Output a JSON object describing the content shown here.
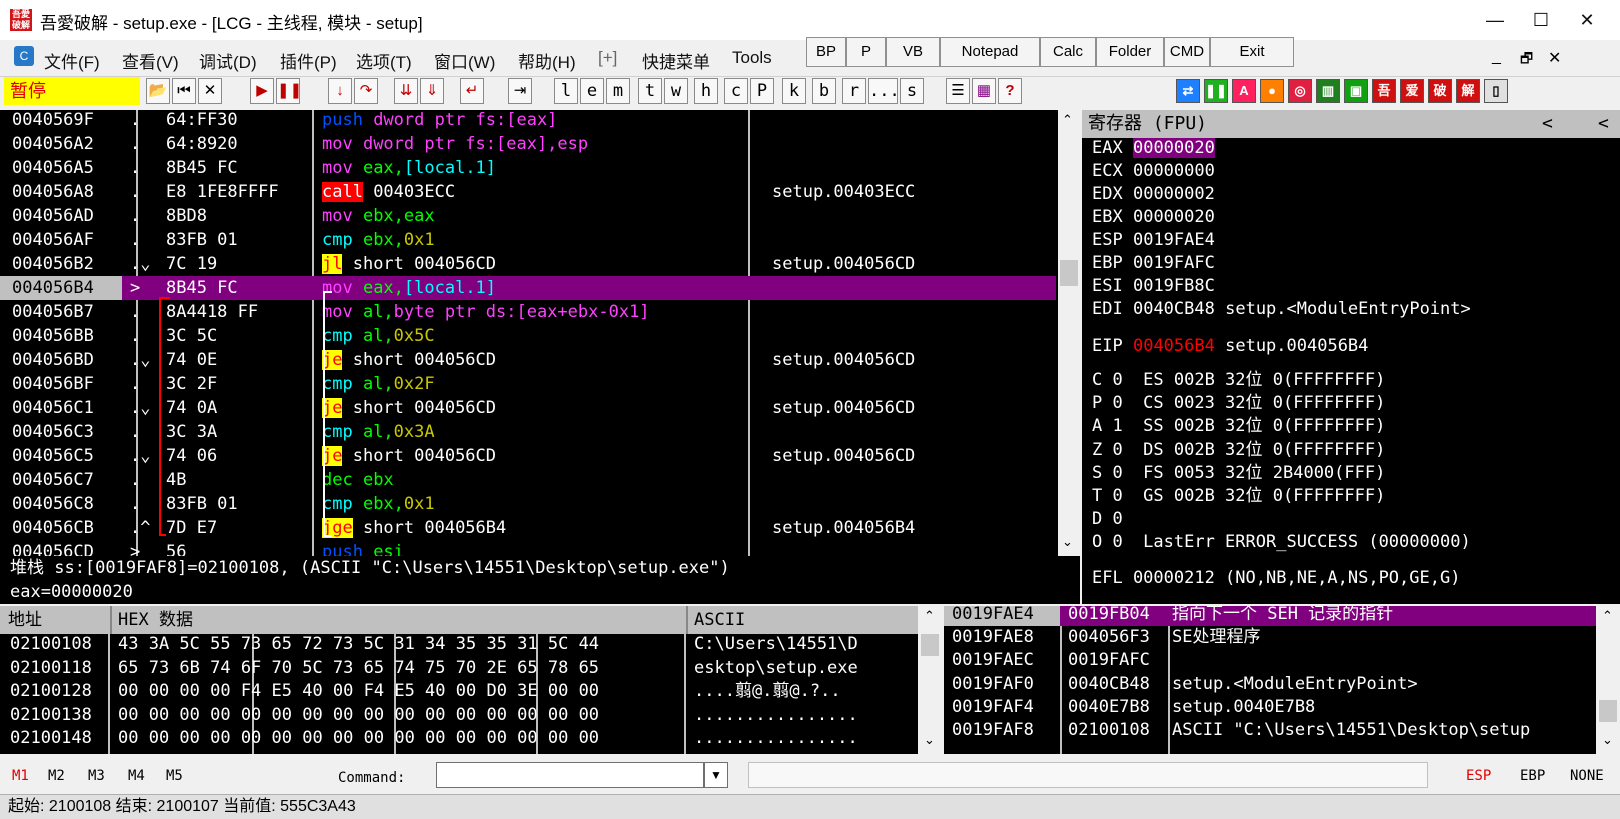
{
  "window": {
    "title": "吾愛破解 - setup.exe - [LCG - 主线程, 模块 - setup]",
    "icon_text": "吾愛破解",
    "minimize": "—",
    "maximize": "☐",
    "close": "✕"
  },
  "menu": [
    "文件(F)",
    "查看(V)",
    "调试(D)",
    "插件(P)",
    "选项(T)",
    "窗口(W)",
    "帮助(H)",
    "[+]",
    "快捷菜单",
    "Tools"
  ],
  "quick_buttons": [
    "BP",
    "P",
    "VB",
    "Notepad",
    "Calc",
    "Folder",
    "CMD",
    "Exit"
  ],
  "mdi_controls": [
    "_",
    "🗗",
    "✕"
  ],
  "toolbar": {
    "status": "暂停",
    "letters": [
      "l",
      "e",
      "m",
      "t",
      "w",
      "h",
      "c",
      "P",
      "k",
      "b",
      "r",
      "...",
      "s"
    ],
    "plugin_icons": [
      "吾",
      "爱",
      "破",
      "解"
    ],
    "plugin_letter": "A"
  },
  "disasm": [
    {
      "addr": "0040569F",
      "mark": ".",
      "hex": "64:FF30",
      "ins": [
        [
          "push",
          "k-push"
        ],
        [
          " dword ptr fs:[eax]",
          "k-op"
        ]
      ],
      "com": ""
    },
    {
      "addr": "004056A2",
      "mark": ".",
      "hex": "64:8920",
      "ins": [
        [
          "mov",
          "k-mov"
        ],
        [
          " dword ptr fs:[eax],esp",
          "k-op"
        ]
      ],
      "com": ""
    },
    {
      "addr": "004056A5",
      "mark": ".",
      "hex": "8B45 FC",
      "ins": [
        [
          "mov",
          "k-mov"
        ],
        [
          " eax,",
          "k-reg"
        ],
        [
          "[local.1]",
          "k-cyan"
        ]
      ],
      "com": ""
    },
    {
      "addr": "004056A8",
      "mark": ".",
      "hex": "E8 1FE8FFFF",
      "ins": [
        [
          "call",
          "k-call"
        ],
        [
          " 00403ECC",
          "k-arg"
        ]
      ],
      "com": "setup.00403ECC"
    },
    {
      "addr": "004056AD",
      "mark": ".",
      "hex": "8BD8",
      "ins": [
        [
          "mov",
          "k-mov"
        ],
        [
          " ebx,eax",
          "k-reg"
        ]
      ],
      "com": ""
    },
    {
      "addr": "004056AF",
      "mark": ".",
      "hex": "83FB 01",
      "ins": [
        [
          "cmp",
          "k-cmp"
        ],
        [
          " ebx,",
          "k-reg"
        ],
        [
          "0x1",
          "k-ol"
        ]
      ],
      "com": ""
    },
    {
      "addr": "004056B2",
      "mark": ".⌄",
      "hex": "7C 19",
      "ins": [
        [
          "jl",
          "k-jmp"
        ],
        [
          " short 004056CD",
          "k-arg"
        ]
      ],
      "com": "setup.004056CD"
    },
    {
      "addr": "004056B4",
      "mark": ">",
      "hex": "8B45 FC",
      "ins": [
        [
          "mov",
          "k-mov"
        ],
        [
          " eax,",
          "k-reg"
        ],
        [
          "[local.1]",
          "k-cyan"
        ]
      ],
      "com": "",
      "sel": true
    },
    {
      "addr": "004056B7",
      "mark": ".",
      "hex": "8A4418 FF",
      "ins": [
        [
          "mov",
          "k-mov"
        ],
        [
          " al,",
          "k-reg"
        ],
        [
          "byte ptr ds:[eax+ebx-0x1]",
          "k-op"
        ]
      ],
      "com": ""
    },
    {
      "addr": "004056BB",
      "mark": ".",
      "hex": "3C 5C",
      "ins": [
        [
          "cmp",
          "k-cmp"
        ],
        [
          " al,",
          "k-reg"
        ],
        [
          "0x5C",
          "k-ol"
        ]
      ],
      "com": ""
    },
    {
      "addr": "004056BD",
      "mark": ".⌄",
      "hex": "74 0E",
      "ins": [
        [
          "je",
          "k-jmp"
        ],
        [
          " short 004056CD",
          "k-arg"
        ]
      ],
      "com": "setup.004056CD"
    },
    {
      "addr": "004056BF",
      "mark": ".",
      "hex": "3C 2F",
      "ins": [
        [
          "cmp",
          "k-cmp"
        ],
        [
          " al,",
          "k-reg"
        ],
        [
          "0x2F",
          "k-ol"
        ]
      ],
      "com": ""
    },
    {
      "addr": "004056C1",
      "mark": ".⌄",
      "hex": "74 0A",
      "ins": [
        [
          "je",
          "k-jmp"
        ],
        [
          " short 004056CD",
          "k-arg"
        ]
      ],
      "com": "setup.004056CD"
    },
    {
      "addr": "004056C3",
      "mark": ".",
      "hex": "3C 3A",
      "ins": [
        [
          "cmp",
          "k-cmp"
        ],
        [
          " al,",
          "k-reg"
        ],
        [
          "0x3A",
          "k-ol"
        ]
      ],
      "com": ""
    },
    {
      "addr": "004056C5",
      "mark": ".⌄",
      "hex": "74 06",
      "ins": [
        [
          "je",
          "k-jmp"
        ],
        [
          " short 004056CD",
          "k-arg"
        ]
      ],
      "com": "setup.004056CD"
    },
    {
      "addr": "004056C7",
      "mark": ".",
      "hex": "4B",
      "ins": [
        [
          "dec",
          "k-dec"
        ],
        [
          " ebx",
          "k-reg"
        ]
      ],
      "com": ""
    },
    {
      "addr": "004056C8",
      "mark": ".",
      "hex": "83FB 01",
      "ins": [
        [
          "cmp",
          "k-cmp"
        ],
        [
          " ebx,",
          "k-reg"
        ],
        [
          "0x1",
          "k-ol"
        ]
      ],
      "com": ""
    },
    {
      "addr": "004056CB",
      "mark": ".^",
      "hex": "7D E7",
      "ins": [
        [
          "jge",
          "k-jmp"
        ],
        [
          " short 004056B4",
          "k-arg"
        ]
      ],
      "com": "setup.004056B4"
    },
    {
      "addr": "004056CD",
      "mark": ">",
      "hex": "56",
      "ins": [
        [
          "push",
          "k-push"
        ],
        [
          " esi",
          "k-reg"
        ]
      ],
      "com": ""
    }
  ],
  "info": {
    "line1": "堆栈 ss:[0019FAF8]=02100108, (ASCII \"C:\\Users\\14551\\Desktop\\setup.exe\")",
    "line2": "eax=00000020"
  },
  "registers": {
    "header": "寄存器 (FPU)",
    "arrows": [
      "<",
      "<"
    ],
    "gp": [
      {
        "name": "EAX",
        "value": "00000020",
        "comment": "",
        "hl": true
      },
      {
        "name": "ECX",
        "value": "00000000",
        "comment": ""
      },
      {
        "name": "EDX",
        "value": "00000002",
        "comment": ""
      },
      {
        "name": "EBX",
        "value": "00000020",
        "comment": ""
      },
      {
        "name": "ESP",
        "value": "0019FAE4",
        "comment": ""
      },
      {
        "name": "EBP",
        "value": "0019FAFC",
        "comment": ""
      },
      {
        "name": "ESI",
        "value": "0019FB8C",
        "comment": ""
      },
      {
        "name": "EDI",
        "value": "0040CB48",
        "comment": "setup.<ModuleEntryPoint>"
      }
    ],
    "eip": {
      "name": "EIP",
      "value": "004056B4",
      "comment": "setup.004056B4"
    },
    "flags": [
      "C 0  ES 002B 32位 0(FFFFFFFF)",
      "P 0  CS 0023 32位 0(FFFFFFFF)",
      "A 1  SS 002B 32位 0(FFFFFFFF)",
      "Z 0  DS 002B 32位 0(FFFFFFFF)",
      "S 0  FS 0053 32位 2B4000(FFF)",
      "T 0  GS 002B 32位 0(FFFFFFFF)",
      "D 0",
      "O 0  LastErr ERROR_SUCCESS (00000000)"
    ],
    "efl": "EFL 00000212 (NO,NB,NE,A,NS,PO,GE,G)"
  },
  "dump": {
    "headers": [
      "地址",
      "HEX 数据",
      "ASCII"
    ],
    "rows": [
      {
        "addr": "02100108",
        "hex": "43 3A 5C 55 73 65 72 73 5C 31 34 35 35 31 5C 44",
        "ascii": "C:\\Users\\14551\\D"
      },
      {
        "addr": "02100118",
        "hex": "65 73 6B 74 6F 70 5C 73 65 74 75 70 2E 65 78 65",
        "ascii": "esktop\\setup.exe"
      },
      {
        "addr": "02100128",
        "hex": "00 00 00 00 F4 E5 40 00 F4 E5 40 00 D0 3E 00 00",
        "ascii": "....翦@.翦@.?.."
      },
      {
        "addr": "02100138",
        "hex": "00 00 00 00 00 00 00 00 00 00 00 00 00 00 00 00",
        "ascii": "................"
      },
      {
        "addr": "02100148",
        "hex": "00 00 00 00 00 00 00 00 00 00 00 00 00 00 00 00",
        "ascii": "................"
      }
    ]
  },
  "stack": [
    {
      "addr": "0019FAE4",
      "val": "0019FB04",
      "com": "指向下一个 SEH 记录的指针",
      "sel": true
    },
    {
      "addr": "0019FAE8",
      "val": "004056F3",
      "com": "SE处理程序"
    },
    {
      "addr": "0019FAEC",
      "val": "0019FAFC",
      "com": ""
    },
    {
      "addr": "0019FAF0",
      "val": "0040CB48",
      "com": "setup.<ModuleEntryPoint>"
    },
    {
      "addr": "0019FAF4",
      "val": "0040E7B8",
      "com": "setup.0040E7B8"
    },
    {
      "addr": "0019FAF8",
      "val": "02100108",
      "com": "ASCII \"C:\\Users\\14551\\Desktop\\setup"
    }
  ],
  "cmdbar": {
    "marks": [
      "M1",
      "M2",
      "M3",
      "M4",
      "M5"
    ],
    "command_label": "Command:",
    "command_value": "",
    "right": [
      "ESP",
      "EBP",
      "NONE"
    ]
  },
  "status": "起始: 2100108 结束: 2100107 当前值: 555C3A43"
}
